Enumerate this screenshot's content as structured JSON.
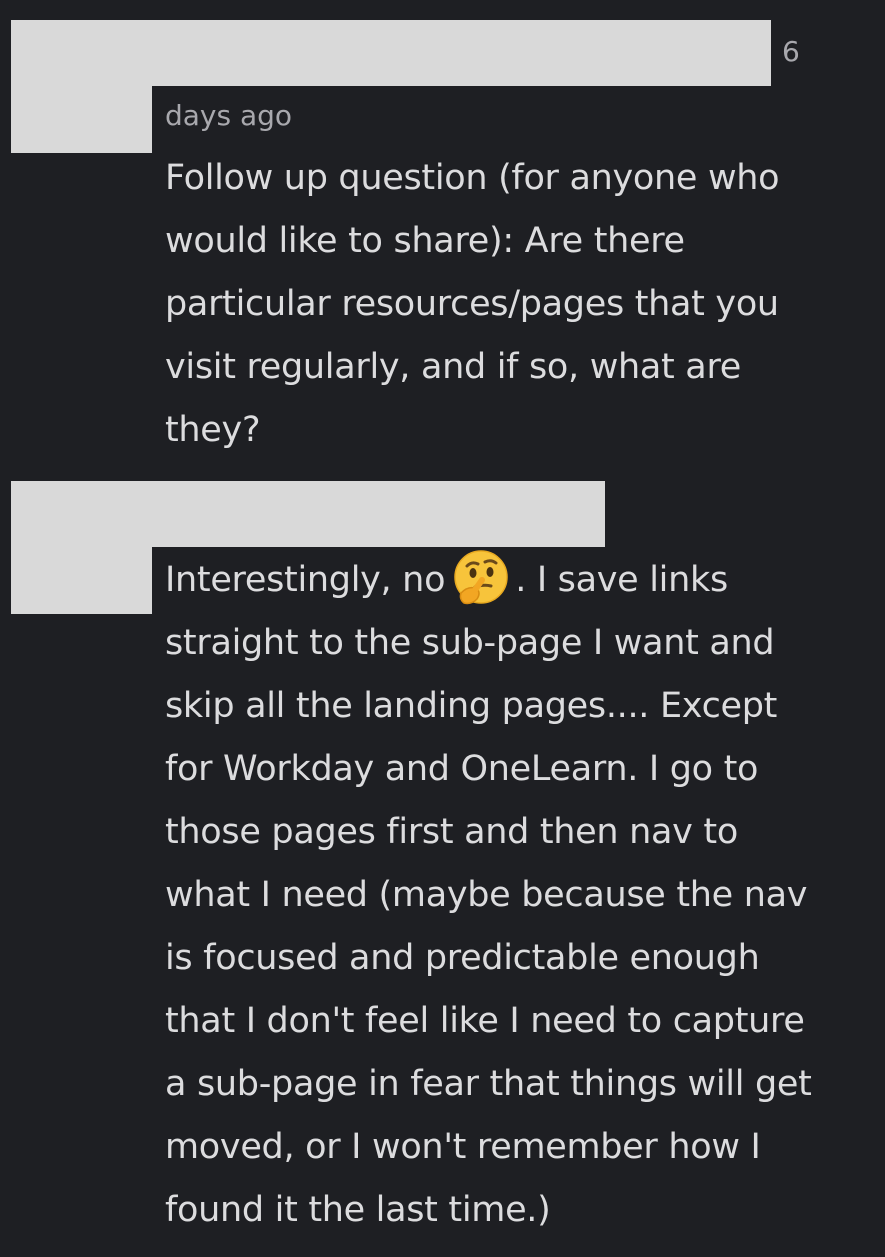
{
  "message1": {
    "timestamp_number": "6",
    "timestamp_rest": "days ago",
    "lines": [
      "Follow up question (for anyone who",
      "would like to share): Are there",
      "particular resources/pages that you",
      "visit regularly, and if so, what are",
      "they?"
    ]
  },
  "message2": {
    "first_line_before_emoji": "Interestingly, no",
    "emoji_icon": "thinking-face-icon",
    "first_line_after_emoji": ". I save links",
    "lines": [
      "straight to the sub-page I want and",
      "skip all the landing pages.... Except",
      "for Workday and OneLearn. I go to",
      "those pages first and then nav to",
      "what I need (maybe because the nav",
      "is focused and predictable enough",
      "that I don't feel like I need to capture",
      "a sub-page in fear that things will get",
      "moved, or I won't remember how I",
      "found it the last time.)"
    ]
  },
  "colors": {
    "background": "#1e1f23",
    "text": "#dcdcde",
    "muted": "#a8a8ad",
    "redaction": "#d9d9d9"
  }
}
